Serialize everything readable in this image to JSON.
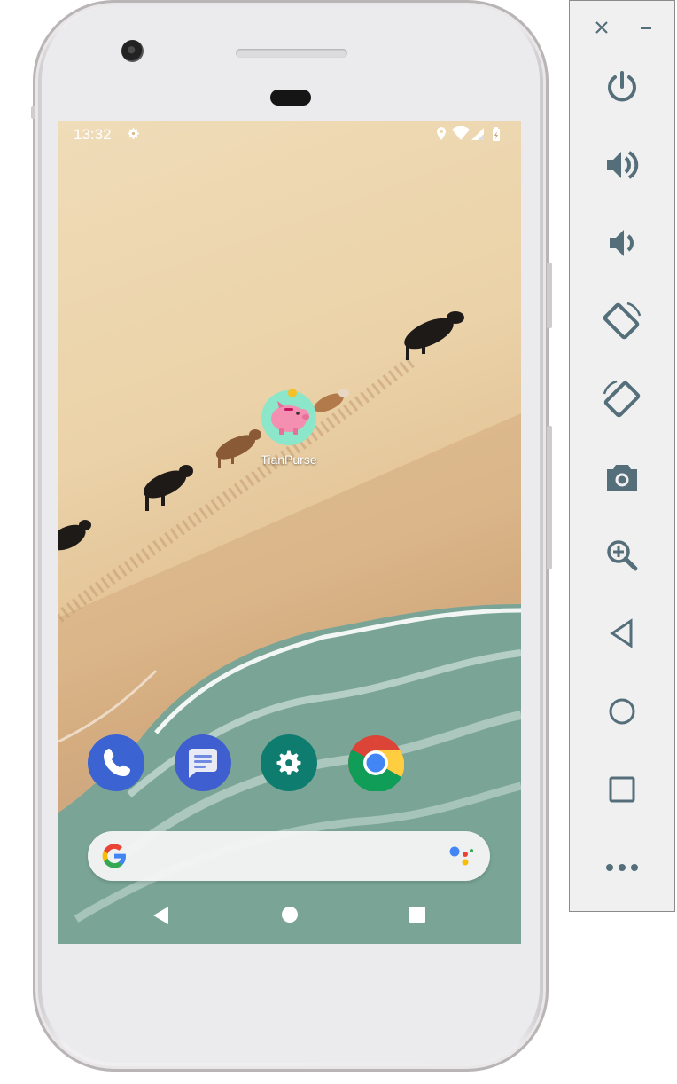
{
  "statusbar": {
    "time": "13:32",
    "icons": [
      "settings-gear-icon",
      "location-icon",
      "wifi-icon",
      "signal-icon",
      "battery-icon"
    ]
  },
  "home": {
    "app_shortcut": {
      "label": "TianPurse",
      "icon": "piggy-bank-icon"
    },
    "dock": [
      {
        "app": "phone",
        "icon": "phone-icon"
      },
      {
        "app": "messages",
        "icon": "messages-icon"
      },
      {
        "app": "settings",
        "icon": "settings-icon"
      },
      {
        "app": "chrome",
        "icon": "chrome-icon"
      }
    ],
    "search_bar": {
      "logo": "google-g-icon",
      "assistant": "google-assistant-icon"
    }
  },
  "navbar": {
    "buttons": [
      "back",
      "home",
      "overview"
    ]
  },
  "emulator_panel": {
    "window_controls": [
      "close",
      "minimize"
    ],
    "tools": [
      "power",
      "volume-up",
      "volume-down",
      "rotate-left",
      "rotate-right",
      "screenshot",
      "zoom",
      "back",
      "home",
      "overview",
      "more"
    ]
  },
  "colors": {
    "panel_icon": "#546e7a",
    "phone_icon_bg": "#3b63d2",
    "messages_icon_bg": "#3f5fd0",
    "settings_icon_bg": "#0e7d6f",
    "piggy_bg": "#8ce6c9",
    "piggy_pink": "#f48fb1"
  }
}
